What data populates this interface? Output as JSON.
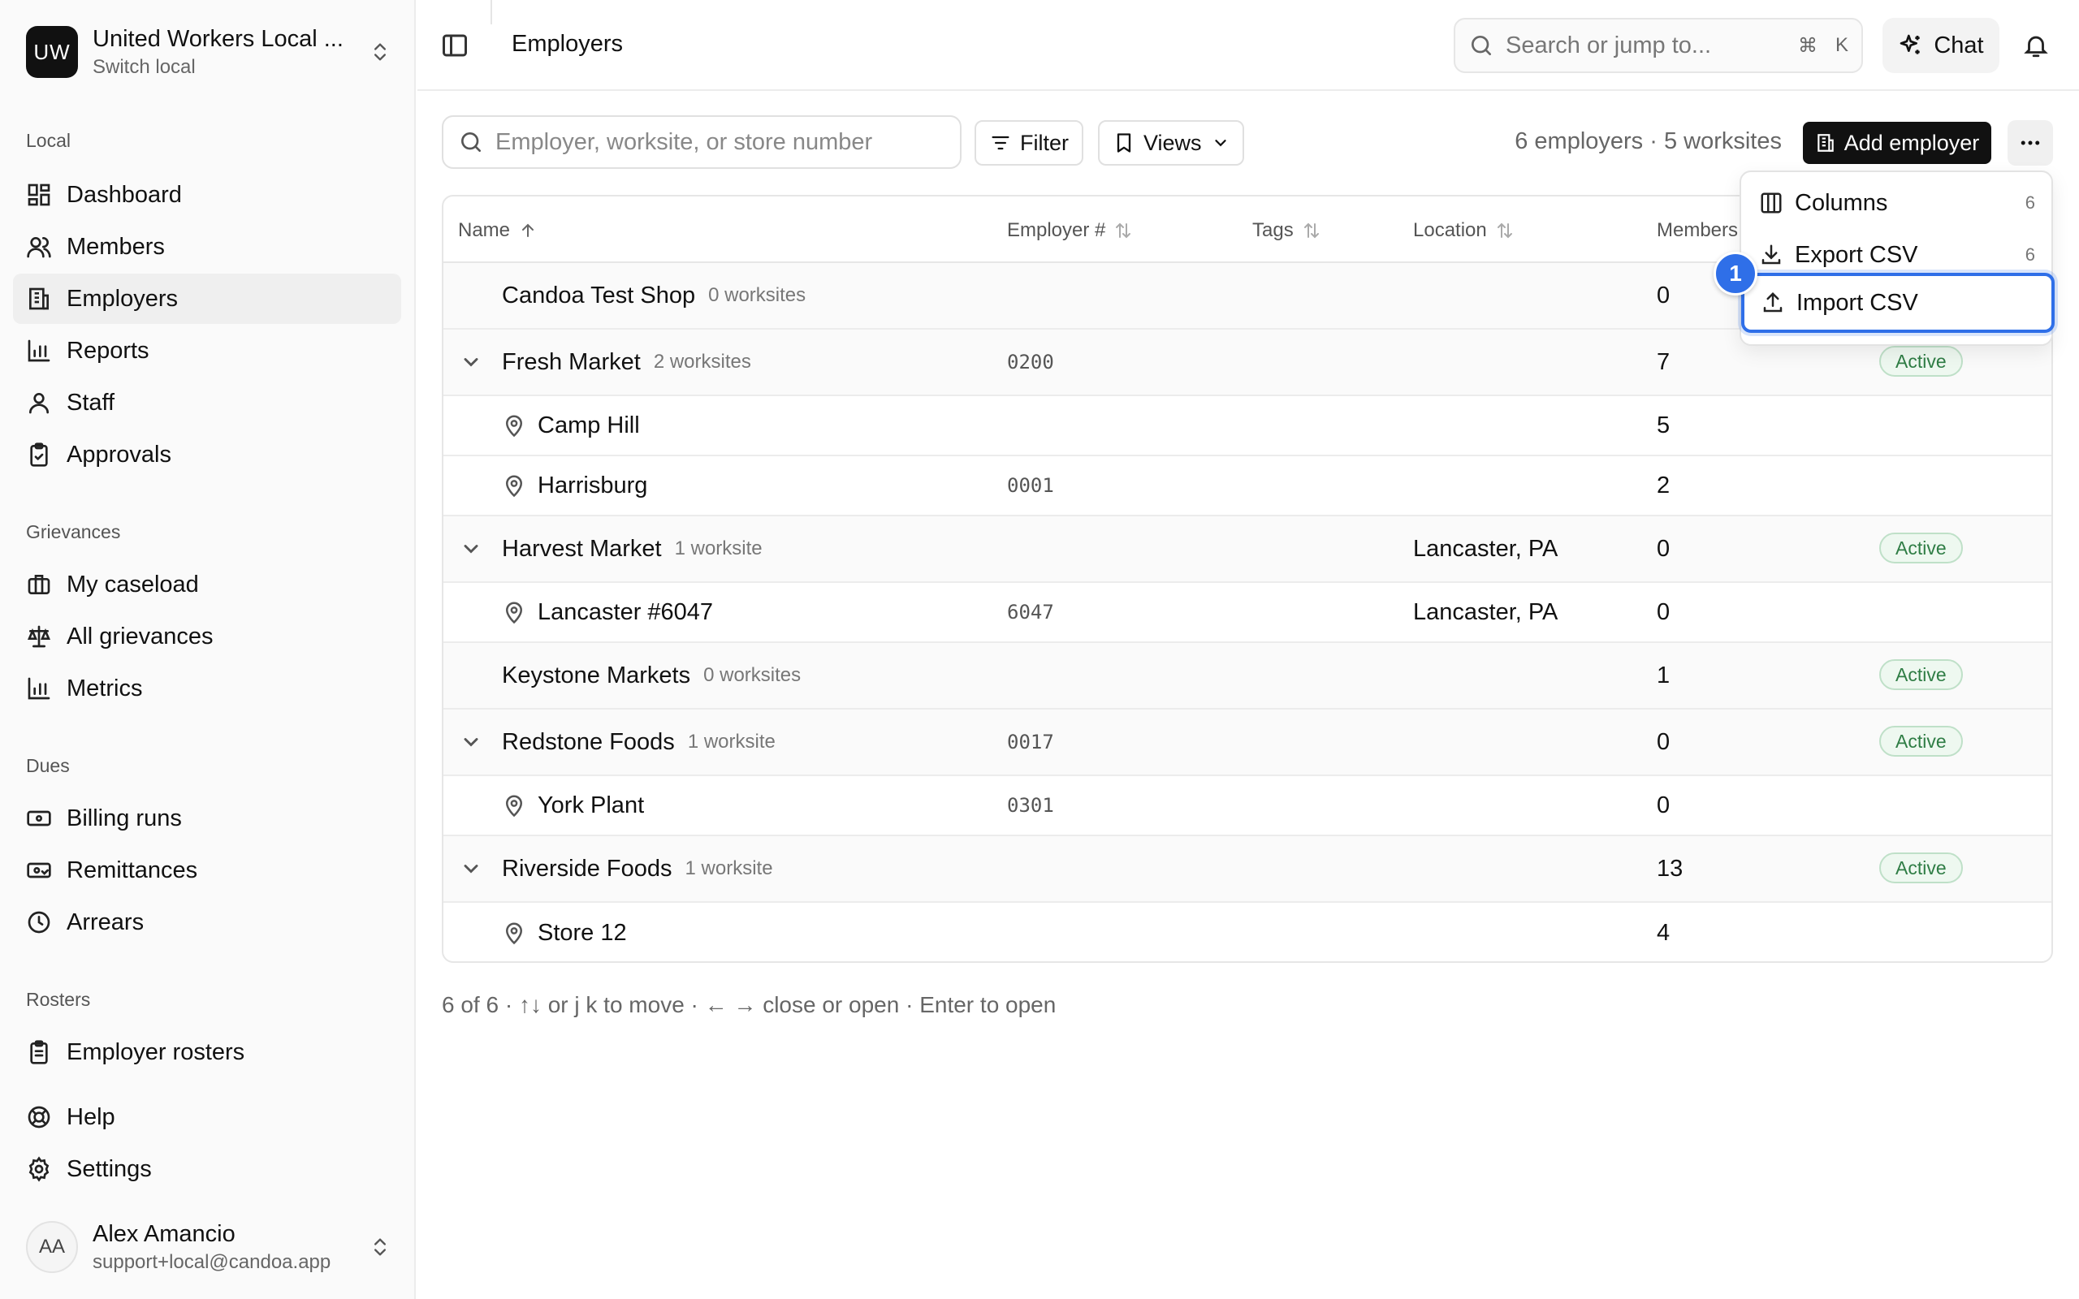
{
  "sidebar": {
    "org_initials": "UW",
    "org_name": "United Workers Local ...",
    "org_sub": "Switch local",
    "sections": {
      "local": "Local",
      "grievances": "Grievances",
      "dues": "Dues",
      "rosters": "Rosters"
    },
    "items": {
      "dashboard": "Dashboard",
      "members": "Members",
      "employers": "Employers",
      "reports": "Reports",
      "staff": "Staff",
      "approvals": "Approvals",
      "my_caseload": "My caseload",
      "all_grievances": "All grievances",
      "metrics": "Metrics",
      "billing_runs": "Billing runs",
      "remittances": "Remittances",
      "arrears": "Arrears",
      "employer_rosters": "Employer rosters",
      "help": "Help",
      "settings": "Settings"
    },
    "user": {
      "initials": "AA",
      "name": "Alex Amancio",
      "email": "support+local@candoa.app"
    }
  },
  "topbar": {
    "title": "Employers",
    "search_placeholder": "Search or jump to...",
    "kbd_cmd": "⌘",
    "kbd_k": "K",
    "chat_label": "Chat"
  },
  "toolbar": {
    "search_placeholder": "Employer, worksite, or store number",
    "filter_label": "Filter",
    "views_label": "Views",
    "counts": "6 employers · 5 worksites",
    "add_label": "Add employer"
  },
  "table": {
    "headers": {
      "name": "Name",
      "employer_no": "Employer #",
      "tags": "Tags",
      "location": "Location",
      "members": "Members"
    },
    "rows": [
      {
        "name": "Candoa Test Shop",
        "worksites": "0 worksites",
        "employer_no": "",
        "location": "",
        "members": "0",
        "status": ""
      },
      {
        "name": "Fresh Market",
        "worksites": "2 worksites",
        "employer_no": "0200",
        "location": "",
        "members": "7",
        "status": "Active"
      },
      {
        "name": "Camp Hill",
        "employer_no": "",
        "location": "",
        "members": "5"
      },
      {
        "name": "Harrisburg",
        "employer_no": "0001",
        "location": "",
        "members": "2"
      },
      {
        "name": "Harvest Market",
        "worksites": "1 worksite",
        "employer_no": "",
        "location": "Lancaster, PA",
        "members": "0",
        "status": "Active"
      },
      {
        "name": "Lancaster #6047",
        "employer_no": "6047",
        "location": "Lancaster, PA",
        "members": "0"
      },
      {
        "name": "Keystone Markets",
        "worksites": "0 worksites",
        "employer_no": "",
        "location": "",
        "members": "1",
        "status": "Active"
      },
      {
        "name": "Redstone Foods",
        "worksites": "1 worksite",
        "employer_no": "0017",
        "location": "",
        "members": "0",
        "status": "Active"
      },
      {
        "name": "York Plant",
        "employer_no": "0301",
        "location": "",
        "members": "0"
      },
      {
        "name": "Riverside Foods",
        "worksites": "1 worksite",
        "employer_no": "",
        "location": "",
        "members": "13",
        "status": "Active"
      },
      {
        "name": "Store 12",
        "employer_no": "",
        "location": "",
        "members": "4"
      }
    ]
  },
  "footer_hint": "6 of 6 · ↑↓ or j k to move · ← → close or open · Enter to open",
  "menu": {
    "columns": "Columns",
    "columns_shortcut": "6",
    "export": "Export CSV",
    "export_shortcut": "6",
    "import": "Import CSV"
  },
  "marker": "1",
  "colors": {
    "accent": "#2f6fe8",
    "active_badge_text": "#2f7d45",
    "active_badge_bg": "#eef8f0"
  }
}
